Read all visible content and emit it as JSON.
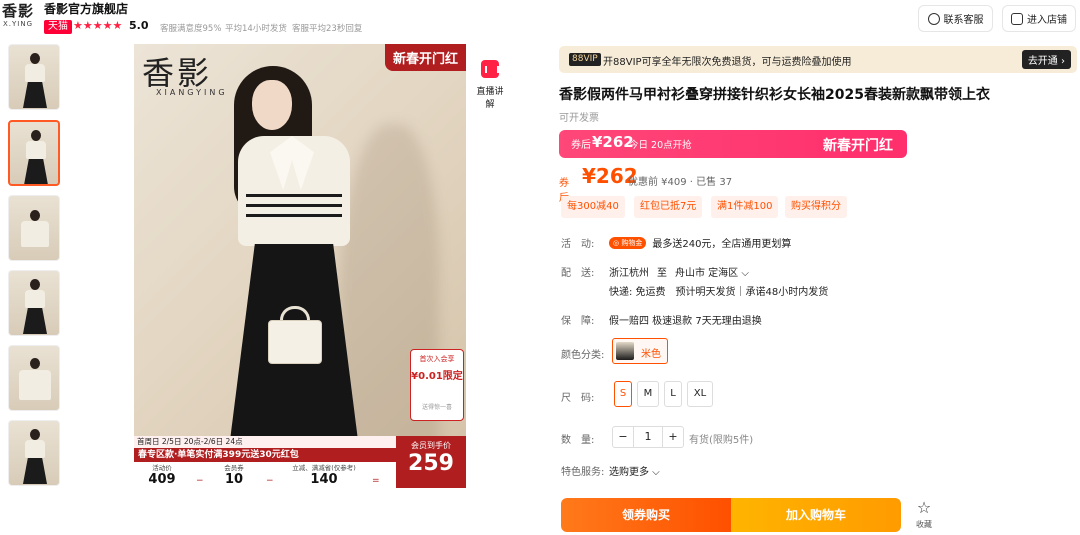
{
  "header": {
    "logo_main": "香影",
    "logo_sub": "X.YING",
    "shop_name": "香影官方旗舰店",
    "tmall_badge": "天猫",
    "stars": "★★★★★",
    "rating": "5.0",
    "stats": [
      "客服满意度95%",
      "平均14小时发货",
      "客服平均23秒回复"
    ],
    "contact_label": "联系客服",
    "store_label": "进入店铺"
  },
  "gallery": {
    "thumb_count": 6,
    "active_index": 1,
    "brand_big": "香影",
    "brand_small": "XIANGYING",
    "promo_tag": "新春开门红",
    "coupon_mini": {
      "top": "首次入会享",
      "amount": "¥0.01限定",
      "bottom": "送得惊一喜"
    },
    "bottom_top": "首周日  2/5日 20点-2/6日 24点",
    "bottom_mid": "春专区款·单笔实付满399元送30元红包",
    "cols": [
      {
        "label": "活动价",
        "value": "409"
      },
      {
        "label": "会员券",
        "value": "10"
      },
      {
        "label": "立减、满减省(仅参考)",
        "value": "140"
      }
    ],
    "ops": [
      "−",
      "−",
      "="
    ],
    "final_label": "会员到手价",
    "final_price": "259",
    "live_label": "直播讲解"
  },
  "vip": {
    "badge": "88VIP",
    "text": "开88VIP可享全年无限次免费退货，可与运费险叠加使用",
    "button": "去开通 ›"
  },
  "product": {
    "title": "香影假两件马甲衬衫叠穿拼接针织衫女长袖2025春装新款飘带领上衣",
    "invoice": "可开发票"
  },
  "banner": {
    "after": "券后",
    "price": "¥262",
    "time": "今日 20点开抢",
    "event": "新春开门红"
  },
  "price": {
    "after_label": "券后",
    "price": "¥262",
    "before": "优惠前 ¥409 · 已售 37"
  },
  "chips": [
    "每300减40",
    "红包已抵7元",
    "满1件减100",
    "购买得积分"
  ],
  "details": {
    "activity_label": "活　动:",
    "activity_badge": "◎ 购物金",
    "activity_text": "最多送240元，全店通用更划算",
    "ship_label": "配　送:",
    "ship_from": "浙江杭州",
    "ship_to_label": "至",
    "ship_to": "舟山市 定海区",
    "ship_detail": "快递: 免运费　预计明天发货｜承诺48小时内发货",
    "guarantee_label": "保　障:",
    "guarantee_text": "假一赔四 极速退款 7天无理由退换",
    "color_label": "颜色分类:",
    "color_option": "米色",
    "size_label": "尺　码:",
    "sizes": [
      "S",
      "M",
      "L",
      "XL"
    ],
    "qty_label": "数　量:",
    "qty_minus": "−",
    "qty_value": "1",
    "qty_plus": "+",
    "stock": "有货(限购5件)",
    "service_label": "特色服务:",
    "service_value": "选购更多 ⌵"
  },
  "actions": {
    "buy": "领券购买",
    "cart": "加入购物车",
    "fav": "收藏"
  },
  "colors": {
    "accent": "#ff5000",
    "tmall": "#ff0036",
    "banner": "#ff3a72",
    "promo_red": "#b01e20"
  }
}
